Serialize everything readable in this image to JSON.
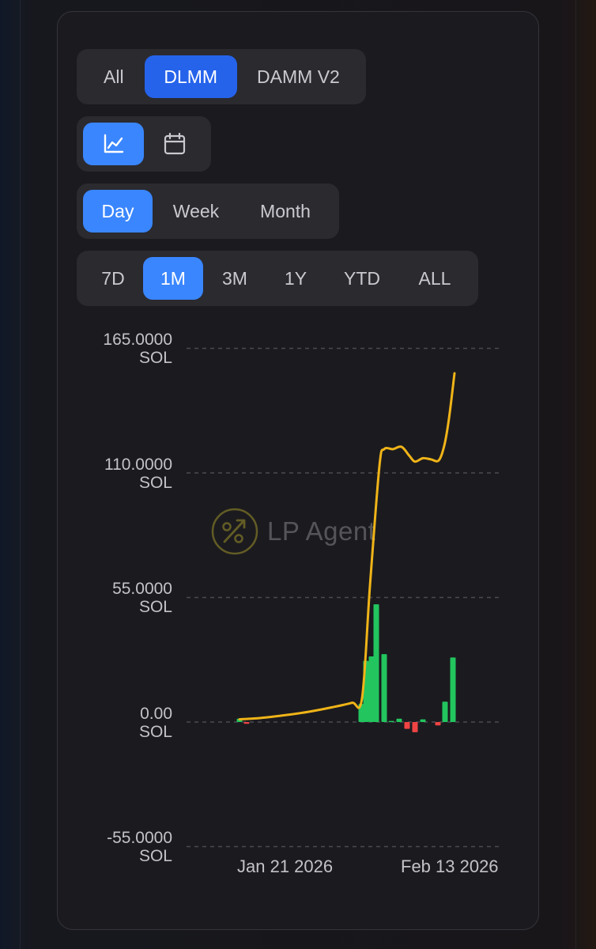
{
  "filters": {
    "pool_types": [
      "All",
      "DLMM",
      "DAMM V2"
    ],
    "pool_type_selected": "DLMM",
    "view_modes": [
      "line-chart-icon",
      "calendar-icon"
    ],
    "view_mode_selected": "line-chart-icon",
    "granularities": [
      "Day",
      "Week",
      "Month"
    ],
    "granularity_selected": "Day",
    "ranges": [
      "7D",
      "1M",
      "3M",
      "1Y",
      "YTD",
      "ALL"
    ],
    "range_selected": "1M"
  },
  "watermark": {
    "text": "LP Agent",
    "icon": "percent-arrow-icon"
  },
  "colors": {
    "accent": "#3a86ff",
    "pool_active": "#2563eb",
    "line": "#f0b418",
    "gain": "#22c55e",
    "loss": "#ef4444",
    "grid": "#4a4a50"
  },
  "chart_data": {
    "type": "bar",
    "overlay": "line",
    "y_ticks": [
      {
        "value": "165.0000",
        "unit": "SOL"
      },
      {
        "value": "110.0000",
        "unit": "SOL"
      },
      {
        "value": "55.0000",
        "unit": "SOL"
      },
      {
        "value": "0.00",
        "unit": "SOL"
      },
      {
        "value": "-55.0000",
        "unit": "SOL"
      }
    ],
    "ylim": [
      -55,
      165
    ],
    "x_tick_labels": [
      "Jan 21 2026",
      "Feb 13 2026"
    ],
    "grid": "horizontal dashed",
    "bars": {
      "description": "daily PnL (SOL)",
      "points": [
        {
          "x": 303,
          "y": 1.5
        },
        {
          "x": 312,
          "y": -0.8
        },
        {
          "x": 457,
          "y": 8
        },
        {
          "x": 463,
          "y": 27
        },
        {
          "x": 470,
          "y": 29
        },
        {
          "x": 476,
          "y": 52
        },
        {
          "x": 486,
          "y": 30
        },
        {
          "x": 495,
          "y": 0.5
        },
        {
          "x": 505,
          "y": 1.5
        },
        {
          "x": 515,
          "y": -3
        },
        {
          "x": 525,
          "y": -4.5
        },
        {
          "x": 535,
          "y": 1.2
        },
        {
          "x": 554,
          "y": -1.5
        },
        {
          "x": 563,
          "y": 9
        },
        {
          "x": 573,
          "y": 28.5
        }
      ]
    },
    "line": {
      "description": "cumulative PnL (SOL)",
      "points": [
        [
          303,
          1.2
        ],
        [
          330,
          1.8
        ],
        [
          360,
          3
        ],
        [
          390,
          4.5
        ],
        [
          420,
          6.5
        ],
        [
          445,
          8.5
        ],
        [
          458,
          10.5
        ],
        [
          468,
          60
        ],
        [
          480,
          113
        ],
        [
          486,
          120.5
        ],
        [
          497,
          120.5
        ],
        [
          508,
          121.5
        ],
        [
          518,
          117.5
        ],
        [
          525,
          115
        ],
        [
          535,
          116.5
        ],
        [
          545,
          116
        ],
        [
          555,
          115.5
        ],
        [
          562,
          122
        ],
        [
          568,
          134
        ],
        [
          575,
          154
        ]
      ]
    }
  }
}
